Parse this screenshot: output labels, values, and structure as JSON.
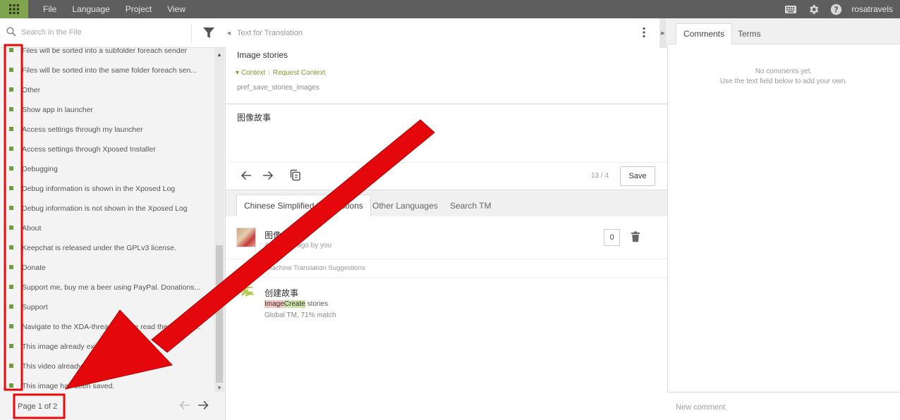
{
  "menu": {
    "items": [
      "File",
      "Language",
      "Project",
      "View"
    ],
    "user": "rosatravels"
  },
  "left": {
    "search_placeholder": "Search in the File",
    "items": [
      "Files will be sorted into a subfolder foreach sender",
      "Files will be sorted into the same folder foreach sen...",
      "Other",
      "Show app in launcher",
      "Access settings through my launcher",
      "Access settings through Xposed Installer",
      "Debugging",
      "Debug information is shown in the Xposed Log",
      "Debug information is not shown in the Xposed Log",
      "About",
      "Keepchat is released under the GPLv3 license.",
      "Donate",
      "Support me, buy me a beer using PayPal. Donations...",
      "Support",
      "Navigate to the XDA-thread, please read the OP first...",
      "This image already exists.",
      "This video already exists.",
      "This image has been saved."
    ],
    "page_label": "Page 1 of 2"
  },
  "editor": {
    "header": "Text for Translation",
    "source": "Image stories",
    "context_label": "Context",
    "request_context": "Request Context",
    "key": "pref_save_stories_images",
    "translation": "图像故事",
    "counter": "13 / 4",
    "save_label": "Save"
  },
  "suggestions": {
    "tabs": [
      "Chinese Simplified Suggestions",
      "Other Languages",
      "Search TM"
    ],
    "own": {
      "text": "图像故事",
      "meta": "4 minutes ago by you",
      "votes": "0"
    },
    "mt_header": "TM and Machine Translation Suggestions",
    "mt": {
      "text": "创建故事",
      "src_del": "Image",
      "src_ins": "Create",
      "src_rest": " stories",
      "meta": "Global TM, 71% match"
    }
  },
  "right": {
    "tabs": [
      "Comments",
      "Terms"
    ],
    "empty_line1": "No comments yet.",
    "empty_line2": "Use the text field below to add your own.",
    "new_comment_placeholder": "New comment"
  },
  "colors": {
    "brand_green": "#7ea44d",
    "annotation_red": "#e8080c"
  }
}
